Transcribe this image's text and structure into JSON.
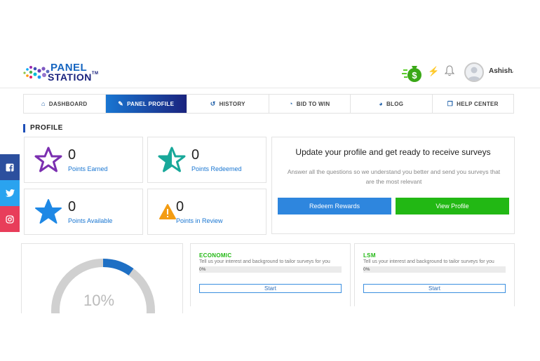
{
  "header": {
    "logo_top": "PANEL",
    "logo_bottom": "STATION",
    "logo_tm": "TM",
    "username": "Ashish"
  },
  "nav": {
    "tabs": [
      {
        "label": "DASHBOARD",
        "icon": "home-icon",
        "active": false
      },
      {
        "label": "PANEL PROFILE",
        "icon": "edit-icon",
        "active": true
      },
      {
        "label": "HISTORY",
        "icon": "history-icon",
        "active": false
      },
      {
        "label": "BID TO WIN",
        "icon": "bid-icon",
        "active": false
      },
      {
        "label": "BLOG",
        "icon": "blog-icon",
        "active": false
      },
      {
        "label": "HELP CENTER",
        "icon": "help-center-icon",
        "active": false
      }
    ]
  },
  "section_title": "PROFILE",
  "stats": {
    "earned": {
      "value": "0",
      "label": "Points Earned"
    },
    "redeemed": {
      "value": "0",
      "label": "Points Redeemed"
    },
    "available": {
      "value": "0",
      "label": "Points Available"
    },
    "review": {
      "value": "0",
      "label": "Points in Review"
    }
  },
  "update": {
    "title": "Update your profile and get ready to receive surveys",
    "description": "Answer all the questions so we understand you better and send you surveys that are the most relevant",
    "redeem_label": "Redeem Rewards",
    "view_label": "View Profile"
  },
  "social": {
    "facebook": "f",
    "twitter": "t",
    "instagram": "ig"
  },
  "progress": {
    "percent_text": "10%",
    "fraction": 0.1
  },
  "surveys": [
    {
      "title": "ECONOMIC",
      "description": "Tell us your interest and background to tailor surveys for you",
      "progress_text": "0%",
      "fraction": 0,
      "button": "Start"
    },
    {
      "title": "LSM",
      "description": "Tell us your interest and background to tailor surveys for you",
      "progress_text": "0%",
      "fraction": 0,
      "button": "Start"
    }
  ],
  "colors": {
    "accent": "#1976d2",
    "green": "#22b814",
    "nav_active_end": "#1a237e"
  }
}
